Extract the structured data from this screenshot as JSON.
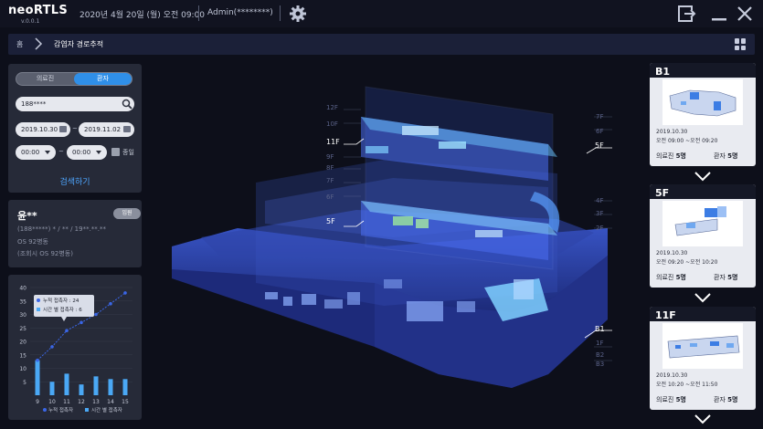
{
  "app": {
    "name": "neoRTLS",
    "version": "v.0.0.1",
    "datetime": "2020년 4월 20일 (월) 오전 09:00",
    "user": "Admin(********)"
  },
  "breadcrumb": {
    "home": "홈",
    "current": "감염자 경로추적"
  },
  "search": {
    "tabs": [
      "의료진",
      "환자"
    ],
    "active_tab": "환자",
    "query": "188****",
    "date_from": "2019.10.30",
    "date_to": "2019.11.02",
    "date_sep": "~",
    "time_from": "00:00",
    "time_to": "00:00",
    "time_sep": "~",
    "allday_label": "종일",
    "button": "검색하기"
  },
  "patient": {
    "name": "윤**",
    "badge": "입원",
    "id_line": "(188*****) * / ** / 19**.**.**",
    "ward": "OS 92병동",
    "ward_note": "(조회시 OS 92병동)"
  },
  "chart_data": {
    "type": "bar",
    "categories": [
      "9",
      "10",
      "11",
      "12",
      "13",
      "14",
      "15"
    ],
    "ylim": [
      0,
      40
    ],
    "yticks": [
      5,
      10,
      15,
      20,
      25,
      30,
      35,
      40
    ],
    "series": [
      {
        "name": "누적 접촉자",
        "kind": "line",
        "values": [
          13,
          18,
          24,
          27,
          30,
          34,
          38
        ],
        "color": "#3a66e6"
      },
      {
        "name": "시간 별 접촉자",
        "kind": "bar",
        "values": [
          13,
          5,
          8,
          4,
          7,
          6,
          6
        ],
        "color": "#4aa8f5"
      }
    ],
    "tooltip": [
      {
        "label": "누적 접촉자 : 24"
      },
      {
        "label": "시간 별 접촉자 : 6"
      }
    ]
  },
  "floor_labels": {
    "left": [
      "11F",
      "5F"
    ],
    "right": [
      "5F",
      "B1"
    ],
    "faint_left": [
      "12F",
      "10F",
      "9F",
      "8F",
      "7F",
      "6F"
    ],
    "faint_right": [
      "7F",
      "6F",
      "4F",
      "3F",
      "2F",
      "1F",
      "B2",
      "B3"
    ]
  },
  "floors": [
    {
      "floor": "B1",
      "date": "2019.10.30",
      "time": "오전 09:00 ~오전 09:20",
      "staff_label": "의료진",
      "staff_count": "5명",
      "patient_label": "환자",
      "patient_count": "5명"
    },
    {
      "floor": "5F",
      "date": "2019.10.30",
      "time": "오전 09:20 ~오전 10:20",
      "staff_label": "의료진",
      "staff_count": "5명",
      "patient_label": "환자",
      "patient_count": "5명"
    },
    {
      "floor": "11F",
      "date": "2019.10.30",
      "time": "오전 10:20 ~오전 11:50",
      "staff_label": "의료진",
      "staff_count": "5명",
      "patient_label": "환자",
      "patient_count": "5명"
    }
  ],
  "colors": {
    "accent": "#2f8fe8",
    "background": "#0d0f1a",
    "panel": "#262a38",
    "building": "#2a3f9a"
  }
}
